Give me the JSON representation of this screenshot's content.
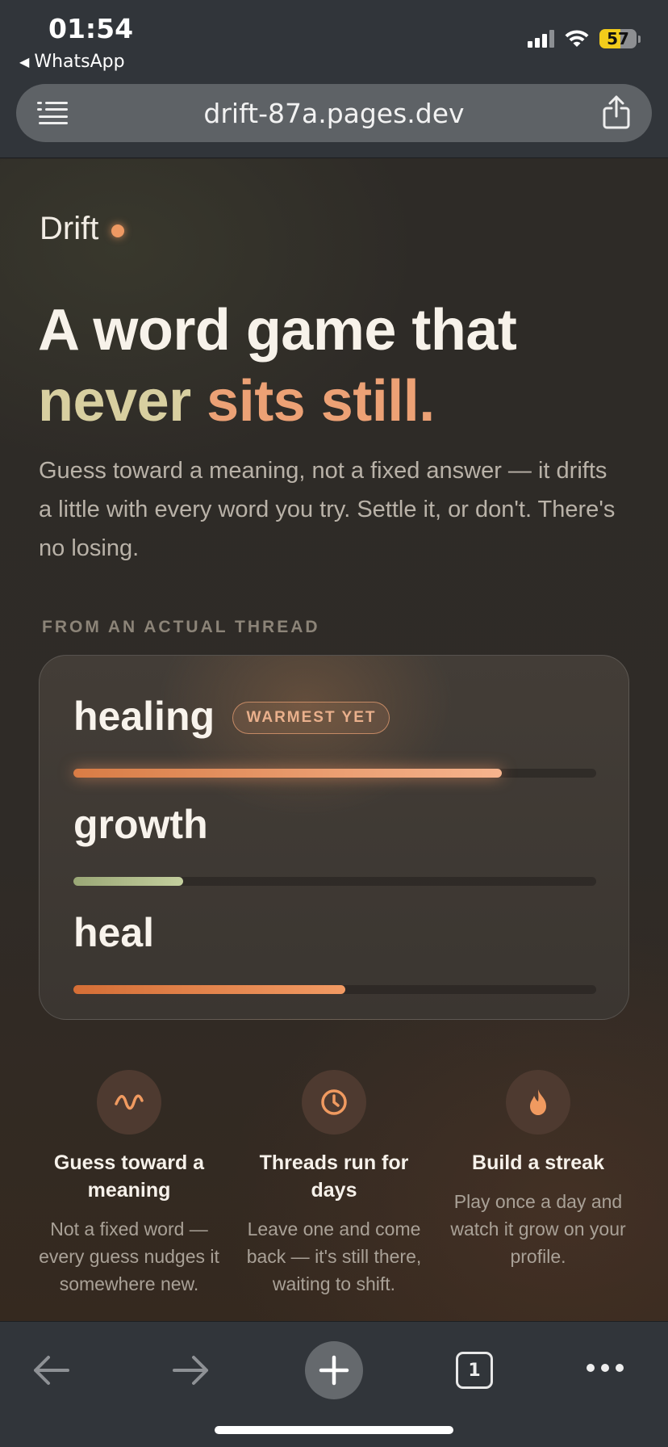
{
  "status_bar": {
    "time": "01:54",
    "back_app": "WhatsApp",
    "battery": "57",
    "battery_level_percent": 57
  },
  "browser": {
    "url": "drift-87a.pages.dev",
    "tab_count": "1"
  },
  "page": {
    "brand": "Drift",
    "headline": {
      "line1": "A word game that",
      "never": "never",
      "sits_still": "sits still."
    },
    "lede": "Guess toward a meaning, not a fixed answer — it drifts a little with every word you try. Settle it, or don't. There's no losing.",
    "eyebrow": "FROM AN ACTUAL THREAD",
    "thread": [
      {
        "word": "healing",
        "badge": "WARMEST YET",
        "warmth": 0.82
      },
      {
        "word": "growth",
        "warmth": 0.21
      },
      {
        "word": "heal",
        "warmth": 0.52
      }
    ],
    "features": [
      {
        "icon": "wave-icon",
        "title": "Guess toward a meaning",
        "desc": "Not a fixed word — every guess nudges it somewhere new."
      },
      {
        "icon": "clock-icon",
        "title": "Threads run for days",
        "desc": "Leave one and come back — it's still there, waiting to shift."
      },
      {
        "icon": "flame-icon",
        "title": "Build a streak",
        "desc": "Play once a day and watch it grow on your profile."
      }
    ]
  },
  "colors": {
    "accent": "#ECA175",
    "accent_green": "#D8CFA0",
    "background": "#2E2B28"
  }
}
